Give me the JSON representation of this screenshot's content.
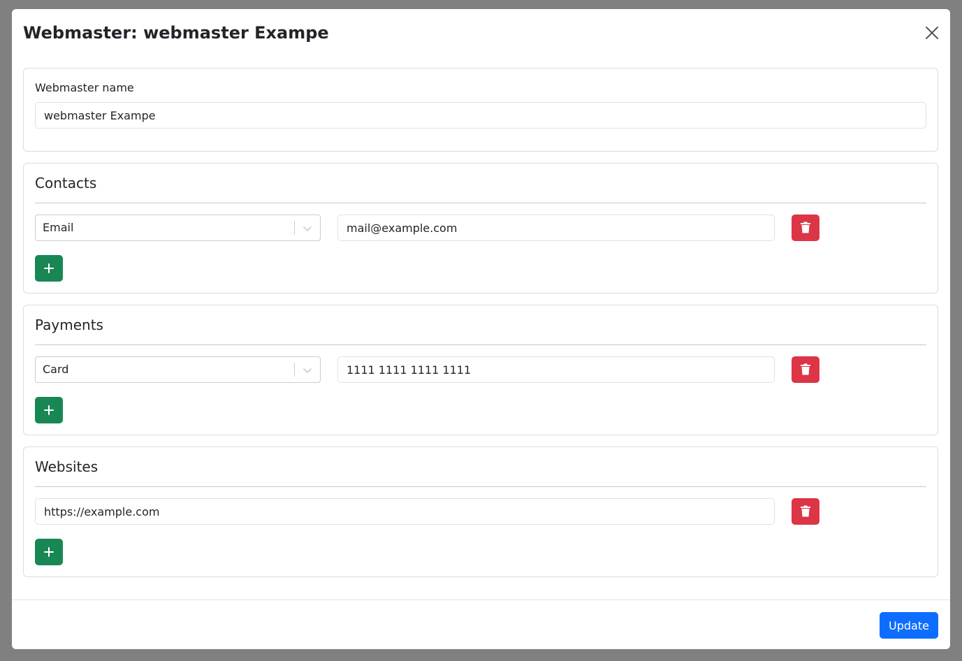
{
  "modal": {
    "title": "Webmaster: webmaster Exampe",
    "close_icon": "close-icon"
  },
  "name_section": {
    "label": "Webmaster name",
    "value": "webmaster Exampe"
  },
  "contacts": {
    "title": "Contacts",
    "items": [
      {
        "type": "Email",
        "value": "mail@example.com"
      }
    ]
  },
  "payments": {
    "title": "Payments",
    "items": [
      {
        "type": "Card",
        "value": "1111 1111 1111 1111"
      }
    ]
  },
  "websites": {
    "title": "Websites",
    "items": [
      {
        "value": "https://example.com"
      }
    ]
  },
  "footer": {
    "update_label": "Update"
  },
  "colors": {
    "backdrop": "#808080",
    "primary": "#0d6efd",
    "success": "#198754",
    "danger": "#dc3545"
  },
  "icons": {
    "delete": "trash-icon",
    "add": "plus-icon",
    "select": "chevron-down-icon"
  }
}
